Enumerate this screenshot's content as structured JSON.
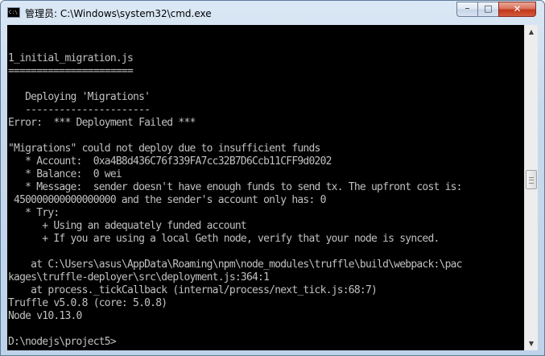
{
  "window": {
    "title": "管理员: C:\\Windows\\system32\\cmd.exe",
    "app_icon_text": "C:\\",
    "minimize_glyph": "–",
    "maximize_glyph": "□",
    "close_glyph": "✕"
  },
  "console": {
    "foreground": "#c0c0c0",
    "background": "#000000",
    "lines": [
      "",
      "",
      "1_initial_migration.js",
      "======================",
      "",
      "   Deploying 'Migrations'",
      "   ----------------------",
      "Error:  *** Deployment Failed ***",
      "",
      "\"Migrations\" could not deploy due to insufficient funds",
      "   * Account:  0xa4B8d436C76f339FA7cc32B7D6Ccb11CFF9d0202",
      "   * Balance:  0 wei",
      "   * Message:  sender doesn't have enough funds to send tx. The upfront cost is:",
      " 450000000000000000 and the sender's account only has: 0",
      "   * Try:",
      "      + Using an adequately funded account",
      "      + If you are using a local Geth node, verify that your node is synced.",
      "",
      "    at C:\\Users\\asus\\AppData\\Roaming\\npm\\node_modules\\truffle\\build\\webpack:\\pac",
      "kages\\truffle-deployer\\src\\deployment.js:364:1",
      "    at process._tickCallback (internal/process/next_tick.js:68:7)",
      "Truffle v5.0.8 (core: 5.0.8)",
      "Node v10.13.0",
      "",
      "D:\\nodejs\\project5>",
      ""
    ]
  },
  "scrollbar": {
    "up_glyph": "▲",
    "down_glyph": "▼",
    "position": 0.47
  }
}
